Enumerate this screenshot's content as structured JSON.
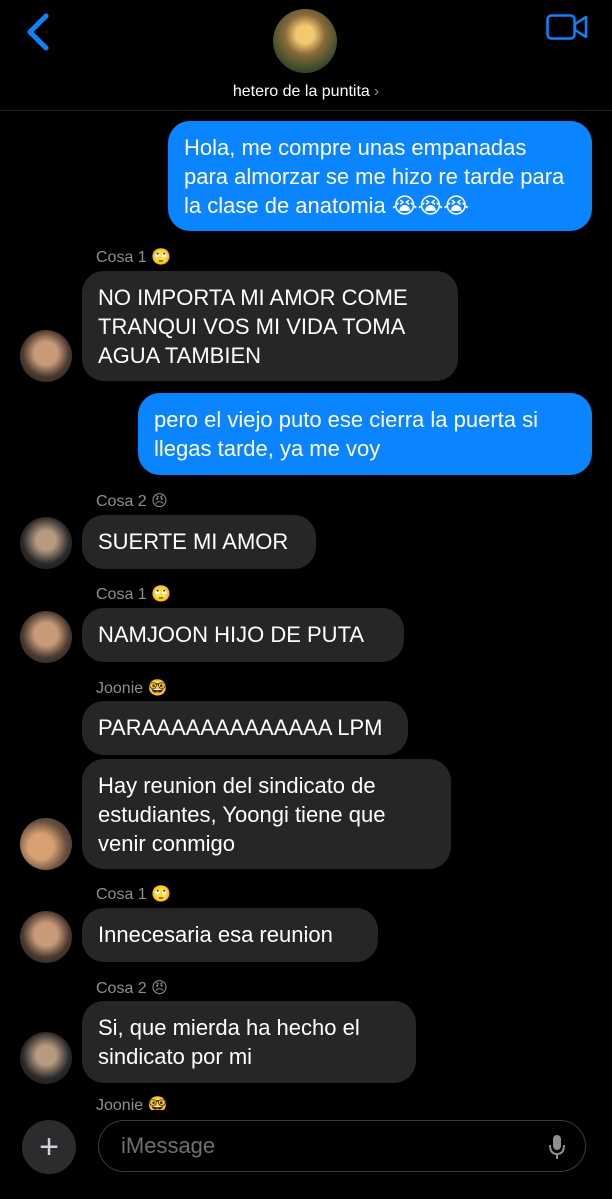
{
  "header": {
    "contact_name": "hetero de la puntita",
    "chevron": "›",
    "back_icon": "chevron-left-icon",
    "video_icon": "video-camera-icon"
  },
  "messages": [
    {
      "side": "out",
      "text": "Hola, me compre unas empanadas para almorzar se me hizo re tarde para la clase de anatomia 😭😭😭"
    },
    {
      "side": "in",
      "sender": "Cosa 1 🙄",
      "text": "NO IMPORTA MI AMOR COME TRANQUI VOS MI VIDA TOMA AGUA TAMBIEN"
    },
    {
      "side": "out",
      "text": "pero el viejo puto ese cierra la puerta si llegas tarde, ya me voy"
    },
    {
      "side": "in",
      "sender": "Cosa 2 😠",
      "text": "SUERTE MI AMOR"
    },
    {
      "side": "in",
      "sender": "Cosa 1 🙄",
      "text": "NAMJOON HIJO DE PUTA"
    },
    {
      "side": "in",
      "sender": "Joonie 🤓",
      "text": "PARAAAAAAAAAAAAA LPM"
    },
    {
      "side": "in",
      "text": "Hay reunion del sindicato de estudiantes, Yoongi tiene que venir conmigo"
    },
    {
      "side": "in",
      "sender": "Cosa 1 🙄",
      "text": "Innecesaria esa reunion"
    },
    {
      "side": "in",
      "sender": "Cosa 2 😠",
      "text": "Si, que mierda ha hecho el sindicato por mi"
    },
    {
      "side": "in",
      "sender": "Joonie 🤓",
      "text": ""
    }
  ],
  "input": {
    "placeholder": "iMessage",
    "plus_label": "+",
    "mic_icon": "microphone-icon"
  },
  "colors": {
    "outgoing": "#0a84ff",
    "incoming": "#262628",
    "background": "#000000",
    "accent": "#0a84ff"
  }
}
